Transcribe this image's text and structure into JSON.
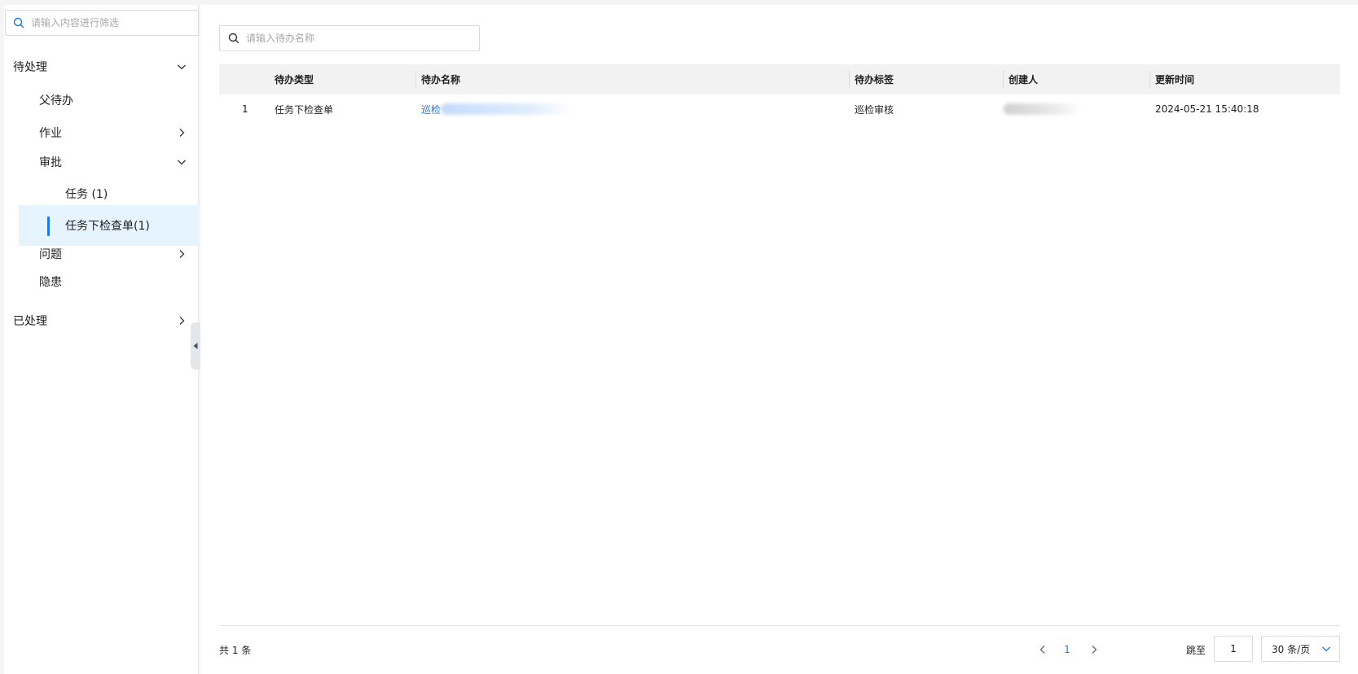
{
  "sidebar": {
    "search_placeholder": "请输入内容进行筛选",
    "tree": [
      {
        "label": "待处理",
        "expanded": true
      },
      {
        "label": "父待办"
      },
      {
        "label": "作业",
        "expanded": false
      },
      {
        "label": "审批",
        "expanded": true
      },
      {
        "label": "任务 (1)"
      },
      {
        "label": "任务下检查单(1)",
        "selected": true
      },
      {
        "label": "问题",
        "expanded": false
      },
      {
        "label": "隐患"
      },
      {
        "label": "已处理",
        "expanded": false
      }
    ]
  },
  "main": {
    "search_placeholder": "请输入待办名称",
    "table": {
      "columns": [
        "待办类型",
        "待办名称",
        "待办标签",
        "创建人",
        "更新时间"
      ],
      "rows": [
        {
          "index": "1",
          "type": "任务下检查单",
          "name": "巡检",
          "tag": "巡检审核",
          "creator": "",
          "updated": "2024-05-21 15:40:18"
        }
      ]
    },
    "pagination": {
      "total_text": "共 1 条",
      "current_page": "1",
      "jump_label": "跳至",
      "jump_value": "1",
      "page_size": "30 条/页"
    }
  },
  "colors": {
    "accent": "#1677ff",
    "selected_bg": "#e6f4ff",
    "header_bg": "#f2f2f2"
  }
}
